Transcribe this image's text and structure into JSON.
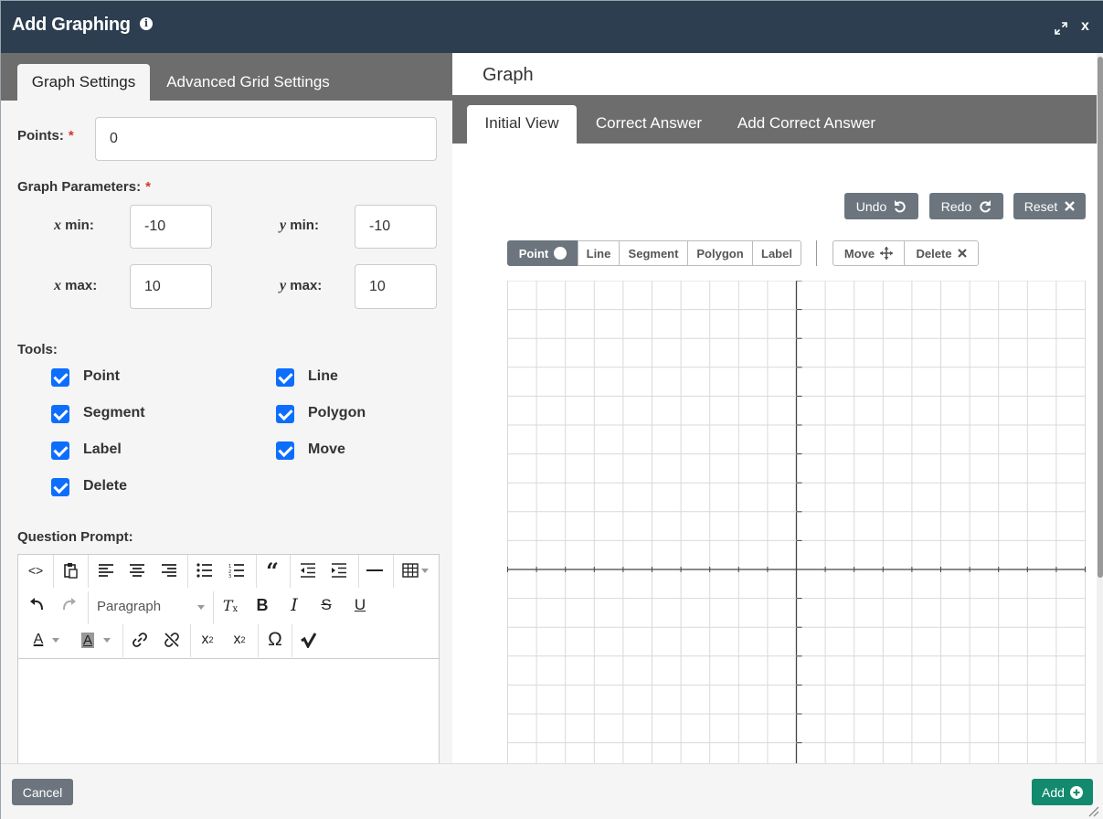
{
  "header": {
    "title": "Add Graphing",
    "info_icon": "info-icon",
    "expand_icon": "expand-icon",
    "close_label": "x"
  },
  "left": {
    "tabs": [
      {
        "label": "Graph Settings",
        "active": true
      },
      {
        "label": "Advanced Grid Settings",
        "active": false
      }
    ],
    "points": {
      "label": "Points:",
      "required": "*",
      "value": "0"
    },
    "graph_parameters": {
      "label": "Graph Parameters:",
      "required": "*",
      "x_min": {
        "var": "x",
        "suffix": " min:",
        "value": "-10"
      },
      "y_min": {
        "var": "y",
        "suffix": " min:",
        "value": "-10"
      },
      "x_max": {
        "var": "x",
        "suffix": " max:",
        "value": "10"
      },
      "y_max": {
        "var": "y",
        "suffix": " max:",
        "value": "10"
      }
    },
    "tools": {
      "label": "Tools:",
      "items": [
        {
          "label": "Point",
          "checked": true
        },
        {
          "label": "Line",
          "checked": true
        },
        {
          "label": "Segment",
          "checked": true
        },
        {
          "label": "Polygon",
          "checked": true
        },
        {
          "label": "Label",
          "checked": true
        },
        {
          "label": "Move",
          "checked": true
        },
        {
          "label": "Delete",
          "checked": true
        }
      ]
    },
    "question_prompt": {
      "label": "Question Prompt:",
      "format_value": "Paragraph"
    }
  },
  "right": {
    "title": "Graph",
    "tabs": [
      {
        "label": "Initial View",
        "active": true
      },
      {
        "label": "Correct Answer",
        "active": false
      },
      {
        "label": "Add Correct Answer",
        "active": false
      }
    ],
    "actions": {
      "undo": "Undo",
      "redo": "Redo",
      "reset": "Reset"
    },
    "graph_tools": {
      "point": "Point",
      "line": "Line",
      "segment": "Segment",
      "polygon": "Polygon",
      "label": "Label",
      "move": "Move",
      "delete": "Delete",
      "active": "Point"
    },
    "grid": {
      "x_min": -10,
      "x_max": 10,
      "y_min": -10,
      "y_max": 10,
      "grid_color": "#d9d9d9",
      "axis_color": "#444444"
    }
  },
  "footer": {
    "cancel": "Cancel",
    "add": "Add"
  },
  "colors": {
    "header": "#2c3e50",
    "tab_bar": "#6d6d6d",
    "checkbox": "#0d6efd",
    "add_button": "#138a6e",
    "secondary_button": "#6c757d",
    "required": "#d9342b"
  }
}
